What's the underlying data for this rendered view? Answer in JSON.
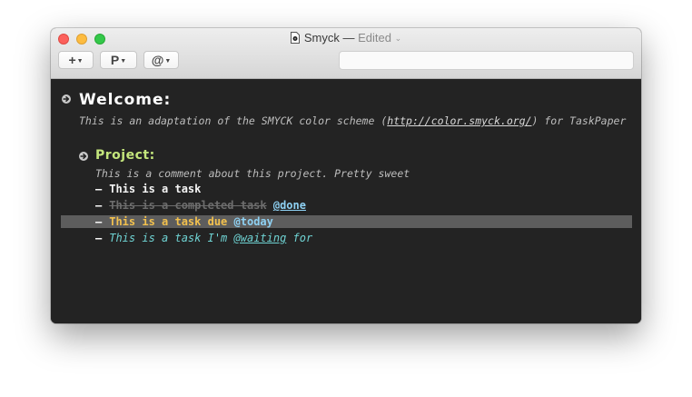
{
  "window": {
    "title": "Smyck",
    "separator": "—",
    "status": "Edited",
    "status_chevron": "⌄"
  },
  "toolbar": {
    "add_label": "+",
    "project_label": "P",
    "tag_label": "@",
    "menu_caret": "▼",
    "search_placeholder": ""
  },
  "document": {
    "heading": "Welcome:",
    "heading_note_before": "This is an adaptation of the SMYCK color scheme (",
    "heading_note_link": "http://color.smyck.org/",
    "heading_note_after": ") for TaskPaper",
    "project": {
      "title": "Project:",
      "note": "This is a comment about this project. Pretty sweet",
      "dash": "–",
      "tasks": [
        {
          "text": "This is a task"
        },
        {
          "text": "This is a completed task",
          "tag": "@done"
        },
        {
          "text": "This is a task due",
          "tag": "@today"
        },
        {
          "text_before": "This is a task I'm",
          "tag": "@waiting",
          "text_after": "for"
        }
      ]
    }
  },
  "colors": {
    "editor_background": "#232323",
    "heading": "#ffffff",
    "project": "#c4e67c",
    "tag": "#8ed1f3",
    "today": "#f2c14e",
    "waiting": "#6fd3d3",
    "done": "#6d6d6d",
    "highlight": "#5d5d5d"
  },
  "icons": {
    "heading_bullet": "arrow-circle-icon",
    "project_bullet": "arrow-circle-icon",
    "document": "document-icon"
  }
}
